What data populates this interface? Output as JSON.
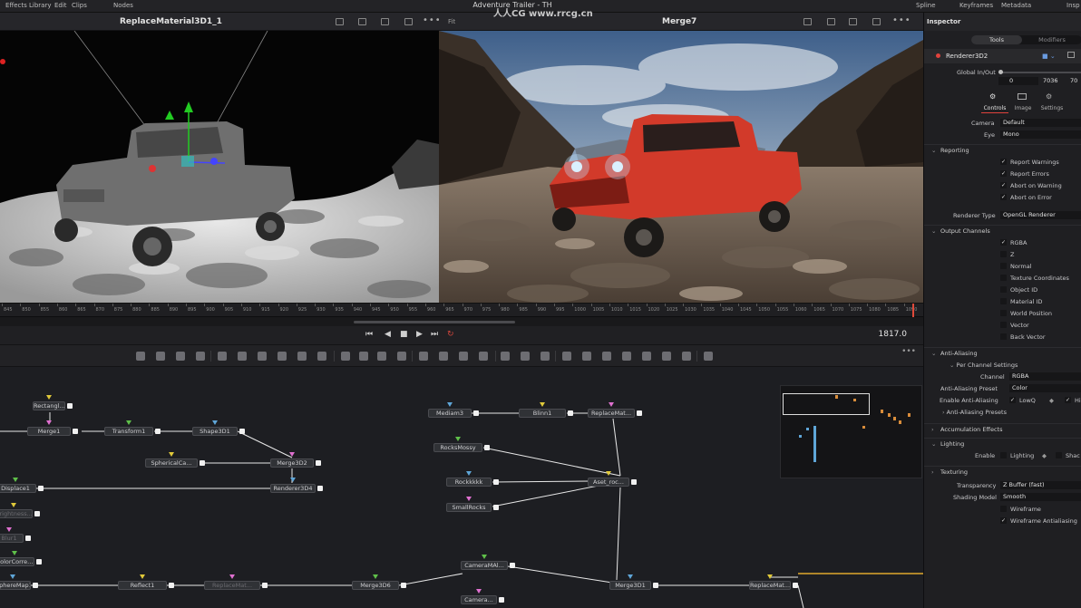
{
  "topbar": {
    "effects_library": "Effects Library",
    "edit": "Edit",
    "clips": "Clips",
    "nodes": "Nodes",
    "project_title": "Adventure Trailer - TH",
    "spline": "Spline",
    "keyframes": "Keyframes",
    "metadata": "Metadata",
    "inspector_tab": "Insp"
  },
  "watermark": "人人CG www.rrcg.cn",
  "viewer_left": {
    "name": "ReplaceMaterial3D1_1"
  },
  "viewer_right": {
    "name": "Merge7",
    "fit": "Fit"
  },
  "ruler": {
    "ticks": [
      "845",
      "850",
      "855",
      "860",
      "865",
      "870",
      "875",
      "880",
      "885",
      "890",
      "895",
      "900",
      "905",
      "910",
      "915",
      "920",
      "925",
      "930",
      "935",
      "940",
      "945",
      "950",
      "955",
      "960",
      "965",
      "970",
      "975",
      "980",
      "985",
      "990",
      "995",
      "1000",
      "1005",
      "1010",
      "1015",
      "1020",
      "1025",
      "1030",
      "1035",
      "1040",
      "1045",
      "1050",
      "1055",
      "1060",
      "1065",
      "1070",
      "1075",
      "1080",
      "1085",
      "1090"
    ]
  },
  "transport": {
    "to_start": "⏮",
    "step_back": "◀",
    "stop": "■",
    "play": "▶",
    "to_end": "⏭",
    "loop": "↻",
    "timecode": "1817.0"
  },
  "nodes": [
    {
      "label": "Rectangl..."
    },
    {
      "label": "Merge1"
    },
    {
      "label": "Transform1"
    },
    {
      "label": "Shape3D1"
    },
    {
      "label": "SphericalCa..."
    },
    {
      "label": "Merge3D2"
    },
    {
      "label": "Displace1"
    },
    {
      "label": "Renderer3D4"
    },
    {
      "label": "Brightness..."
    },
    {
      "label": "Blur1"
    },
    {
      "label": "ColorCorre..."
    },
    {
      "label": "SphereMap1"
    },
    {
      "label": "Reflect1"
    },
    {
      "label": "ReplaceMat..."
    },
    {
      "label": "Merge3D6"
    },
    {
      "label": "Mediam3"
    },
    {
      "label": "Blinn1"
    },
    {
      "label": "ReplaceMat..."
    },
    {
      "label": "RocksMossy"
    },
    {
      "label": "Rockkkkk"
    },
    {
      "label": "Aset_roc..."
    },
    {
      "label": "SmallRocks"
    },
    {
      "label": "CameraMAl..."
    },
    {
      "label": "Merge3D1"
    },
    {
      "label": "ReplaceMat..."
    },
    {
      "label": "Camera..."
    }
  ],
  "inspector": {
    "title": "Inspector",
    "tabs": {
      "tools": "Tools",
      "modifiers": "Modifiers"
    },
    "tool_name": "Renderer3D2",
    "global_in_out_label": "Global In/Out",
    "global_in": "0",
    "global_out": "7036",
    "global_out2": "70",
    "subtabs": [
      "Controls",
      "Image",
      "Settings"
    ],
    "camera_label": "Camera",
    "camera_value": "Default",
    "eye_label": "Eye",
    "eye_value": "Mono",
    "reporting": {
      "title": "Reporting",
      "items": [
        {
          "label": "Report Warnings",
          "checked": true
        },
        {
          "label": "Report Errors",
          "checked": true
        },
        {
          "label": "Abort on Warning",
          "checked": true
        },
        {
          "label": "Abort on Error",
          "checked": true
        }
      ]
    },
    "renderer_type_label": "Renderer Type",
    "renderer_type_value": "OpenGL Renderer",
    "output_channels": {
      "title": "Output Channels",
      "items": [
        {
          "label": "RGBA",
          "checked": true
        },
        {
          "label": "Z",
          "checked": false
        },
        {
          "label": "Normal",
          "checked": false
        },
        {
          "label": "Texture Coordinates",
          "checked": false
        },
        {
          "label": "Object ID",
          "checked": false
        },
        {
          "label": "Material ID",
          "checked": false
        },
        {
          "label": "World Position",
          "checked": false
        },
        {
          "label": "Vector",
          "checked": false
        },
        {
          "label": "Back Vector",
          "checked": false
        }
      ]
    },
    "anti_aliasing": {
      "title": "Anti-Aliasing",
      "per_channel": "Per Channel Settings",
      "channel_label": "Channel",
      "channel_value": "RGBA",
      "preset_label": "Anti-Aliasing Preset",
      "preset_value": "Color",
      "enable_label": "Enable Anti-Aliasing",
      "lowq": "LowQ",
      "hiq": "Hi",
      "presets": "Anti-Aliasing Presets"
    },
    "accumulation_effects": "Accumulation Effects",
    "lighting": {
      "title": "Lighting",
      "enable_label": "Enable",
      "lighting_opt": "Lighting",
      "shadows_opt": "Shac"
    },
    "texturing": "Texturing",
    "transparency_label": "Transparency",
    "transparency_value": "Z Buffer (fast)",
    "shading_label": "Shading Model",
    "shading_value": "Smooth",
    "wireframe": {
      "label": "Wireframe",
      "checked": false
    },
    "wireframe_aa": {
      "label": "Wireframe Antialiasing",
      "checked": true
    }
  }
}
